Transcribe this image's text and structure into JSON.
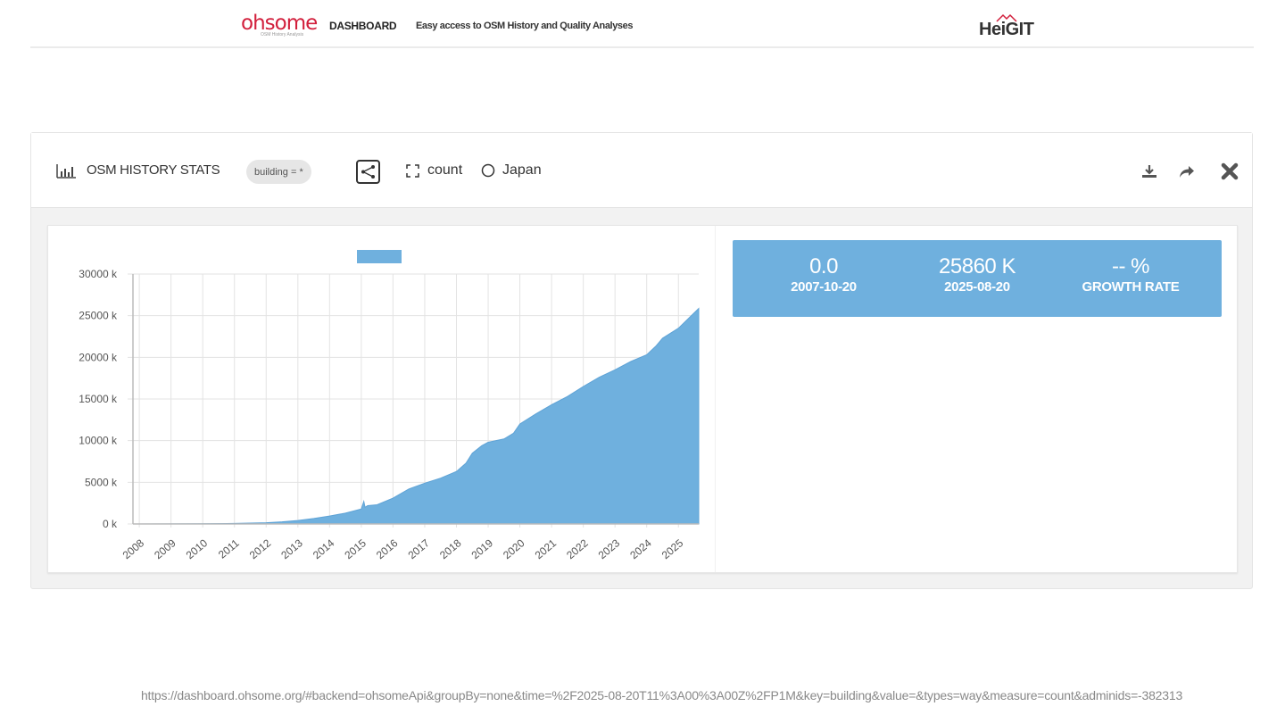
{
  "header": {
    "logo_text": "ohsome",
    "logo_subtitle": "OSM History Analysis",
    "logo_suffix": "DASHBOARD",
    "tagline": "Easy access to OSM History and Quality Analyses",
    "partner_logo": "HeiGIT"
  },
  "widget": {
    "title": "OSM HISTORY STATS",
    "filter_tag": "building = *",
    "measure": "count",
    "region": "Japan",
    "icons": {
      "title": "bar-chart-icon",
      "share_map": "network-icon",
      "measure": "expand-icon",
      "region": "circle-icon",
      "download": "download-icon",
      "share": "share-icon",
      "close": "close-icon"
    }
  },
  "stats": {
    "start_value": "0.0",
    "start_date": "2007-10-20",
    "end_value": "25860 K",
    "end_date": "2025-08-20",
    "growth_value": "-- %",
    "growth_label": "GROWTH RATE",
    "color": "#6fb0de"
  },
  "chart_data": {
    "type": "area",
    "title": "",
    "xlabel": "",
    "ylabel": "",
    "color": "#6fb0de",
    "legend": "top-center",
    "grid": true,
    "ylim": [
      0,
      30000
    ],
    "y_ticks": [
      "0 k",
      "5000 k",
      "10000 k",
      "15000 k",
      "20000 k",
      "25000 k",
      "30000 k"
    ],
    "x_ticks": [
      "2008",
      "2009",
      "2010",
      "2011",
      "2012",
      "2013",
      "2014",
      "2015",
      "2016",
      "2017",
      "2018",
      "2019",
      "2020",
      "2021",
      "2022",
      "2023",
      "2024",
      "2025"
    ],
    "xlim": [
      2007.8,
      2025.64
    ],
    "series": [
      {
        "x": [
          2007.8,
          2009.0,
          2010.0,
          2011.0,
          2012.0,
          2012.5,
          2013.0,
          2013.5,
          2014.0,
          2014.5,
          2015.0,
          2015.08,
          2015.12,
          2015.2,
          2015.5,
          2016.0,
          2016.5,
          2017.0,
          2017.5,
          2018.0,
          2018.3,
          2018.5,
          2018.8,
          2019.0,
          2019.5,
          2019.8,
          2020.0,
          2020.5,
          2021.0,
          2021.5,
          2022.0,
          2022.5,
          2023.0,
          2023.5,
          2024.0,
          2024.3,
          2024.5,
          2025.0,
          2025.3,
          2025.64
        ],
        "y": [
          0,
          10,
          30,
          60,
          150,
          260,
          420,
          650,
          950,
          1300,
          1800,
          2700,
          2000,
          2200,
          2300,
          3100,
          4200,
          4900,
          5500,
          6300,
          7300,
          8500,
          9400,
          9800,
          10200,
          10900,
          12000,
          13200,
          14300,
          15300,
          16500,
          17600,
          18500,
          19500,
          20300,
          21400,
          22300,
          23500,
          24600,
          25860
        ]
      }
    ]
  },
  "url": "https://dashboard.ohsome.org/#backend=ohsomeApi&groupBy=none&time=%2F2025-08-20T11%3A00%3A00Z%2FP1M&key=building&value=&types=way&measure=count&adminids=-382313"
}
